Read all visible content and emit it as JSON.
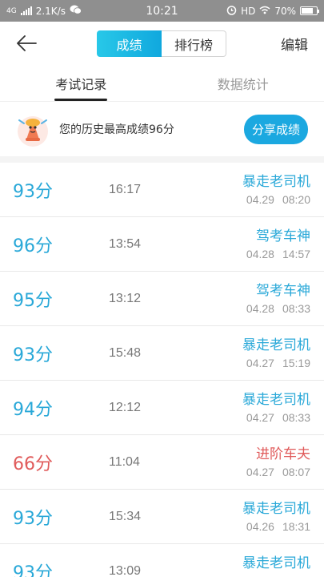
{
  "status_bar": {
    "network": "4G",
    "speed": "2.1K/s",
    "time": "10:21",
    "hd": "HD",
    "battery": "70%"
  },
  "navbar": {
    "segments": [
      "成绩",
      "排行榜"
    ],
    "edit_label": "编辑"
  },
  "tabs": [
    "考试记录",
    "数据统计"
  ],
  "best": {
    "text": "您的历史最高成绩96分",
    "share_label": "分享成绩"
  },
  "records": [
    {
      "score": "93分",
      "duration": "16:17",
      "title": "暴走老司机",
      "date": "04.29",
      "time": "08:20",
      "fail": false
    },
    {
      "score": "96分",
      "duration": "13:54",
      "title": "驾考车神",
      "date": "04.28",
      "time": "14:57",
      "fail": false
    },
    {
      "score": "95分",
      "duration": "13:12",
      "title": "驾考车神",
      "date": "04.28",
      "time": "08:33",
      "fail": false
    },
    {
      "score": "93分",
      "duration": "15:48",
      "title": "暴走老司机",
      "date": "04.27",
      "time": "15:19",
      "fail": false
    },
    {
      "score": "94分",
      "duration": "12:12",
      "title": "暴走老司机",
      "date": "04.27",
      "time": "08:33",
      "fail": false
    },
    {
      "score": "66分",
      "duration": "11:04",
      "title": "进阶车夫",
      "date": "04.27",
      "time": "08:07",
      "fail": true
    },
    {
      "score": "93分",
      "duration": "15:34",
      "title": "暴走老司机",
      "date": "04.26",
      "time": "18:31",
      "fail": false
    },
    {
      "score": "93分",
      "duration": "13:09",
      "title": "暴走老司机",
      "date": "",
      "time": "",
      "fail": false
    }
  ],
  "colors": {
    "accent": "#29a8d8",
    "fail": "#e05a5a",
    "share_button": "#1ba8e0"
  }
}
